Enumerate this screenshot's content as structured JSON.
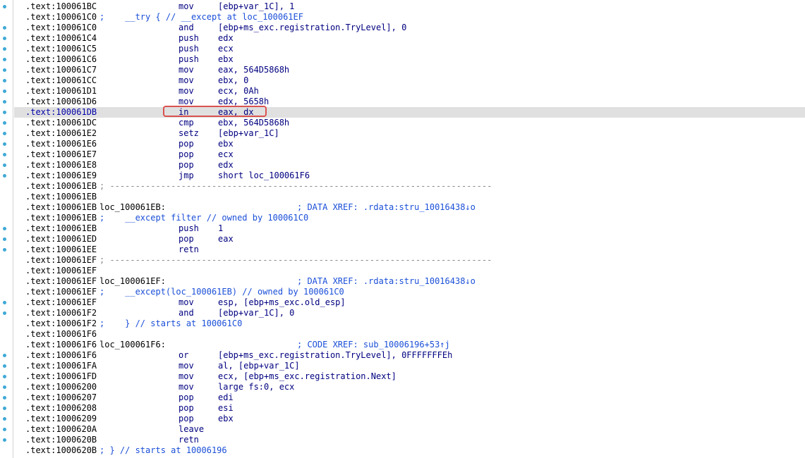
{
  "colors": {
    "gutter_dot": "#3fa9d6",
    "highlight_row": "#e0e0e0",
    "annotation_box": "#d9534f",
    "instruction": "#000080",
    "comment": "#1a4fd8",
    "immediate": "#006400"
  },
  "lines": [
    {
      "a": ".text:100061BC",
      "m": "mov",
      "o": "[ebp+var_1C], 1"
    },
    {
      "a": ".text:100061C0",
      "c": ";    __try { // __except at loc_100061EF"
    },
    {
      "a": ".text:100061C0",
      "m": "and",
      "o": "[ebp+ms_exc.registration.TryLevel], 0"
    },
    {
      "a": ".text:100061C4",
      "m": "push",
      "o": "edx"
    },
    {
      "a": ".text:100061C5",
      "m": "push",
      "o": "ecx"
    },
    {
      "a": ".text:100061C6",
      "m": "push",
      "o": "ebx"
    },
    {
      "a": ".text:100061C7",
      "m": "mov",
      "o": "eax, 564D5868h"
    },
    {
      "a": ".text:100061CC",
      "m": "mov",
      "o": "ebx, 0"
    },
    {
      "a": ".text:100061D1",
      "m": "mov",
      "o": "ecx, 0Ah"
    },
    {
      "a": ".text:100061D6",
      "m": "mov",
      "o": "edx, 5658h"
    },
    {
      "a": ".text:100061DB",
      "m": "in",
      "o": "eax, dx",
      "highlight": true
    },
    {
      "a": ".text:100061DC",
      "m": "cmp",
      "o": "ebx, 564D5868h"
    },
    {
      "a": ".text:100061E2",
      "m": "setz",
      "o": "[ebp+var_1C]"
    },
    {
      "a": ".text:100061E6",
      "m": "pop",
      "o": "ebx"
    },
    {
      "a": ".text:100061E7",
      "m": "pop",
      "o": "ecx"
    },
    {
      "a": ".text:100061E8",
      "m": "pop",
      "o": "edx"
    },
    {
      "a": ".text:100061E9",
      "m": "jmp",
      "o": "short loc_100061F6"
    },
    {
      "a": ".text:100061EB",
      "c": "; ---------------------------------------------------------------------------"
    },
    {
      "a": ".text:100061EB"
    },
    {
      "a": ".text:100061EB",
      "l": "loc_100061EB:",
      "x": "; DATA XREF: .rdata:stru_10016438↓o"
    },
    {
      "a": ".text:100061EB",
      "c": ";    __except filter // owned by 100061C0"
    },
    {
      "a": ".text:100061EB",
      "m": "push",
      "o": "1"
    },
    {
      "a": ".text:100061ED",
      "m": "pop",
      "o": "eax"
    },
    {
      "a": ".text:100061EE",
      "m": "retn"
    },
    {
      "a": ".text:100061EF",
      "c": "; ---------------------------------------------------------------------------"
    },
    {
      "a": ".text:100061EF"
    },
    {
      "a": ".text:100061EF",
      "l": "loc_100061EF:",
      "x": "; DATA XREF: .rdata:stru_10016438↓o"
    },
    {
      "a": ".text:100061EF",
      "c": ";    __except(loc_100061EB) // owned by 100061C0"
    },
    {
      "a": ".text:100061EF",
      "m": "mov",
      "o": "esp, [ebp+ms_exc.old_esp]"
    },
    {
      "a": ".text:100061F2",
      "m": "and",
      "o": "[ebp+var_1C], 0"
    },
    {
      "a": ".text:100061F2",
      "c": ";    } // starts at 100061C0"
    },
    {
      "a": ".text:100061F6"
    },
    {
      "a": ".text:100061F6",
      "l": "loc_100061F6:",
      "x": "; CODE XREF: sub_10006196+53↑j"
    },
    {
      "a": ".text:100061F6",
      "m": "or",
      "o": "[ebp+ms_exc.registration.TryLevel], 0FFFFFFFEh"
    },
    {
      "a": ".text:100061FA",
      "m": "mov",
      "o": "al, [ebp+var_1C]"
    },
    {
      "a": ".text:100061FD",
      "m": "mov",
      "o": "ecx, [ebp+ms_exc.registration.Next]"
    },
    {
      "a": ".text:10006200",
      "m": "mov",
      "o": "large fs:0, ecx"
    },
    {
      "a": ".text:10006207",
      "m": "pop",
      "o": "edi"
    },
    {
      "a": ".text:10006208",
      "m": "pop",
      "o": "esi"
    },
    {
      "a": ".text:10006209",
      "m": "pop",
      "o": "ebx"
    },
    {
      "a": ".text:1000620A",
      "m": "leave"
    },
    {
      "a": ".text:1000620B",
      "m": "retn"
    },
    {
      "a": ".text:1000620B",
      "c": "; } // starts at 10006196"
    }
  ]
}
